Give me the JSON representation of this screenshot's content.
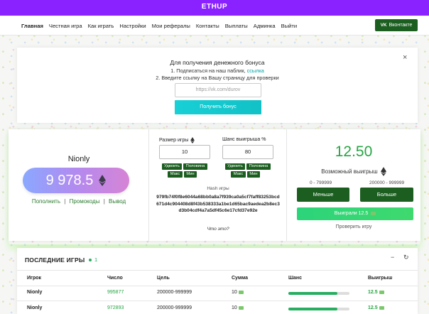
{
  "brand": "ETHUP",
  "nav": {
    "links": [
      "Главная",
      "Честная игра",
      "Как играть",
      "Настройки",
      "Мои рефералы",
      "Контакты",
      "Выплаты",
      "Админка",
      "Выйти"
    ],
    "vk_button": "Вконтакте",
    "vk_logo": "VK"
  },
  "bonus": {
    "title": "Для получения денежного бонуса",
    "step1_prefix": "1. Подписаться на наш паблик,",
    "step1_link": "ссылка",
    "step2": "2. Введите ссылку на Вашу страницу для проверки",
    "input_placeholder": "https://vk.com/durov",
    "button": "Получить бонус",
    "close": "×"
  },
  "player": {
    "username": "Nionly",
    "balance": "9 978.5",
    "links": [
      "Пополнить",
      "Промокоды",
      "Вывод"
    ],
    "separator": "|"
  },
  "bet": {
    "size_label": "Размер игры",
    "size_value": "10",
    "chance_label": "Шанс выигрыша %",
    "chance_value": "80",
    "size_buttons": [
      "Удвоить",
      "Половина",
      "Макс",
      "Мин"
    ],
    "chance_buttons": [
      "Удвоить",
      "Половина",
      "Макс",
      "Мин"
    ],
    "hash_title": "Hash игры",
    "hash": "979fb74f0f8e6044a68bb0a8a7f939ca0a5cf7faff83253bcd671d4c904408d8f43b538333a1be1d65bac9aedea2b8ec3d3b04cdf4a7a5df45c6e17cfd37e92e",
    "hash_help": "Что это?"
  },
  "result": {
    "possible_win": "12.50",
    "possible_win_label": "Возможный выигрыш",
    "range_low": "0 - 799999",
    "range_high": "200000 - 999999",
    "less_button": "Меньше",
    "more_button": "Больше",
    "won_text": "Выиграли 12.5",
    "verify": "Проверить игру"
  },
  "recent_games": {
    "title": "ПОСЛЕДНИЕ ИГРЫ",
    "online": "1",
    "minimize": "−",
    "refresh": "↻",
    "columns": [
      "Игрок",
      "Число",
      "Цель",
      "Сумма",
      "Шанс",
      "Выигрыш"
    ],
    "rows": [
      {
        "player": "Nionly",
        "number": "995877",
        "target": "200000-999999",
        "amount": "10",
        "chance": 80,
        "win": "12.5"
      },
      {
        "player": "Nionly",
        "number": "972893",
        "target": "200000-999999",
        "amount": "10",
        "chance": 80,
        "win": "12.5"
      }
    ]
  },
  "colors": {
    "brand_purple": "#8a22ff",
    "dark_green": "#1b5e20",
    "accent_green": "#26a543",
    "teal": "#18d0d6"
  }
}
